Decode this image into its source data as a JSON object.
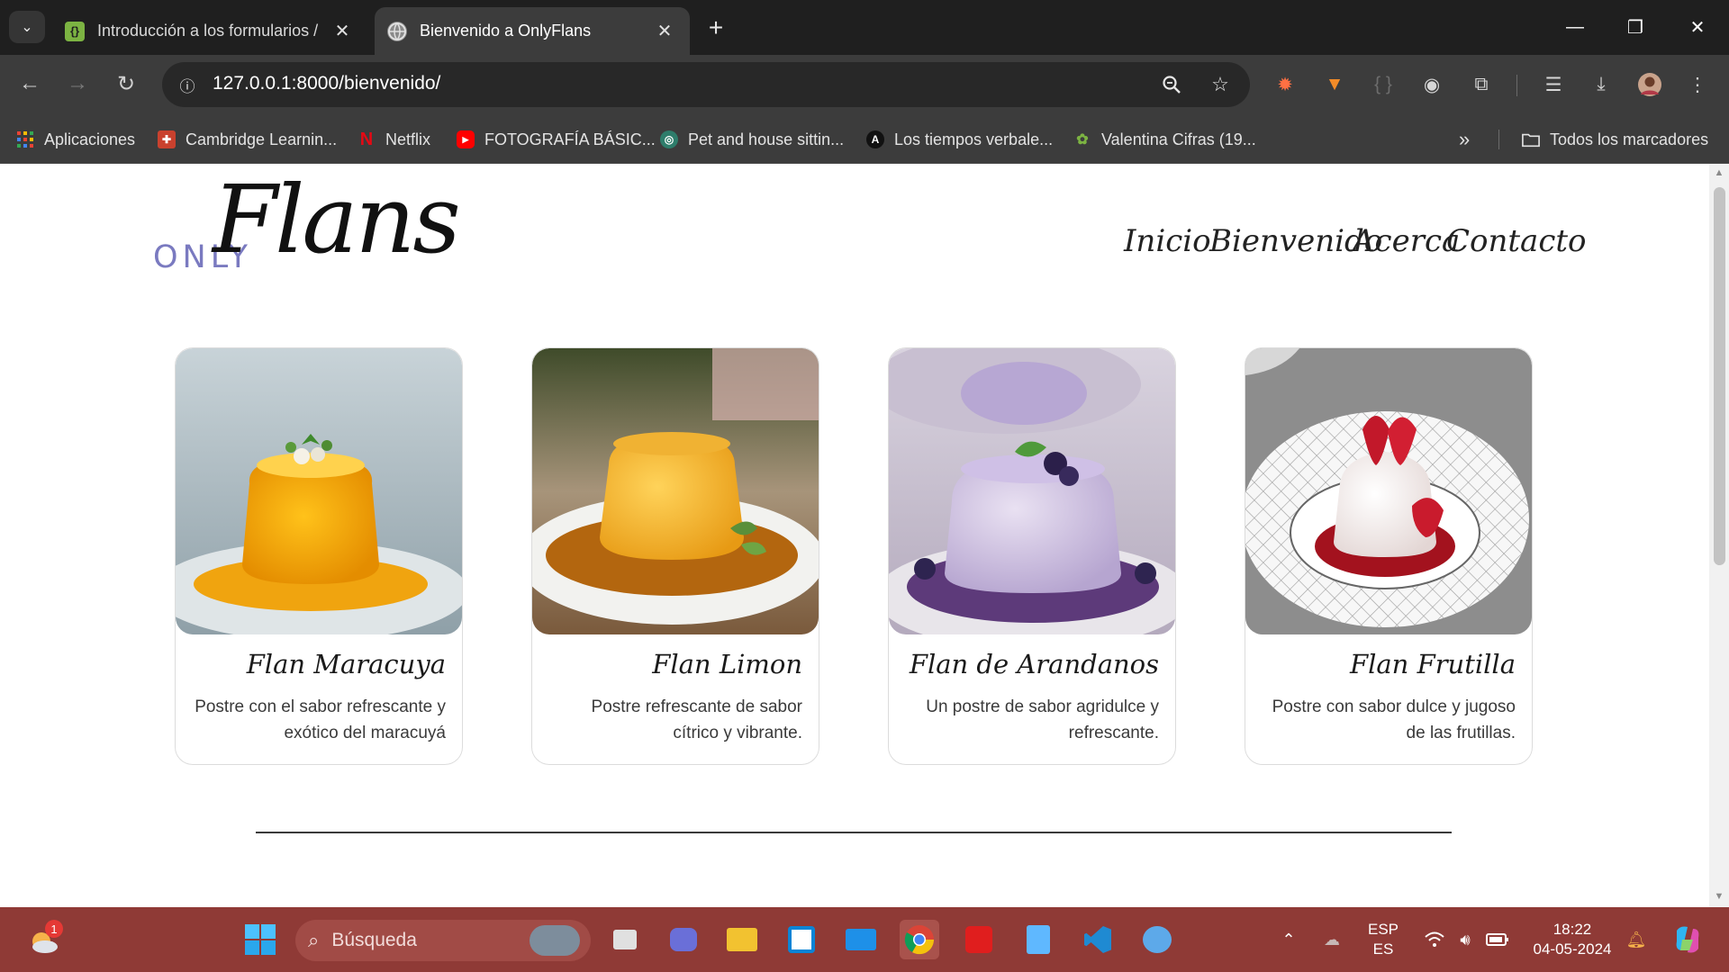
{
  "browser": {
    "tabs": [
      {
        "title": "Introducción a los formularios /",
        "active": false,
        "favicon": "formularios-icon"
      },
      {
        "title": "Bienvenido a OnlyFlans",
        "active": true,
        "favicon": "globe-icon"
      }
    ],
    "url": "127.0.0.1:8000/bienvenido/",
    "bookmarks": [
      {
        "label": "Aplicaciones",
        "icon": "apps-grid-icon"
      },
      {
        "label": "Cambridge Learnin...",
        "icon": "cambridge-icon"
      },
      {
        "label": "Netflix",
        "icon": "netflix-icon"
      },
      {
        "label": "FOTOGRAFÍA BÁSIC...",
        "icon": "youtube-icon"
      },
      {
        "label": "Pet and house sittin...",
        "icon": "pet-icon"
      },
      {
        "label": "Los tiempos verbale...",
        "icon": "letter-a-icon"
      },
      {
        "label": "Valentina Cifras (19...",
        "icon": "plant-icon"
      }
    ],
    "all_bookmarks_label": "Todos los marcadores",
    "more_bookmarks": "»"
  },
  "page": {
    "logo_only": "ONLY",
    "logo_flans": "Flans",
    "nav": [
      "Inicio",
      "Bienvenido",
      "Acerca",
      "Contacto"
    ],
    "cards": [
      {
        "title": "Flan Maracuya",
        "description": "Postre con el sabor refrescante y exótico del maracuyá",
        "image": "flan-maracuya-image"
      },
      {
        "title": "Flan Limon",
        "description": "Postre refrescante de sabor cítrico y vibrante.",
        "image": "flan-limon-image"
      },
      {
        "title": "Flan de Arandanos",
        "description": "Un postre de sabor agridulce y refrescante.",
        "image": "flan-arandanos-image"
      },
      {
        "title": "Flan Frutilla",
        "description": "Postre con sabor dulce y jugoso de las frutillas.",
        "image": "flan-frutilla-image"
      }
    ]
  },
  "taskbar": {
    "search_placeholder": "Búsqueda",
    "weather_badge": "1",
    "language_top": "ESP",
    "language_bottom": "ES",
    "time": "18:22",
    "date": "04-05-2024"
  },
  "colors": {
    "tabstrip": "#1f1f1f",
    "toolbar": "#3c3c3c",
    "taskbar": "#8f3a36",
    "logo_only": "#7a7ac0"
  }
}
